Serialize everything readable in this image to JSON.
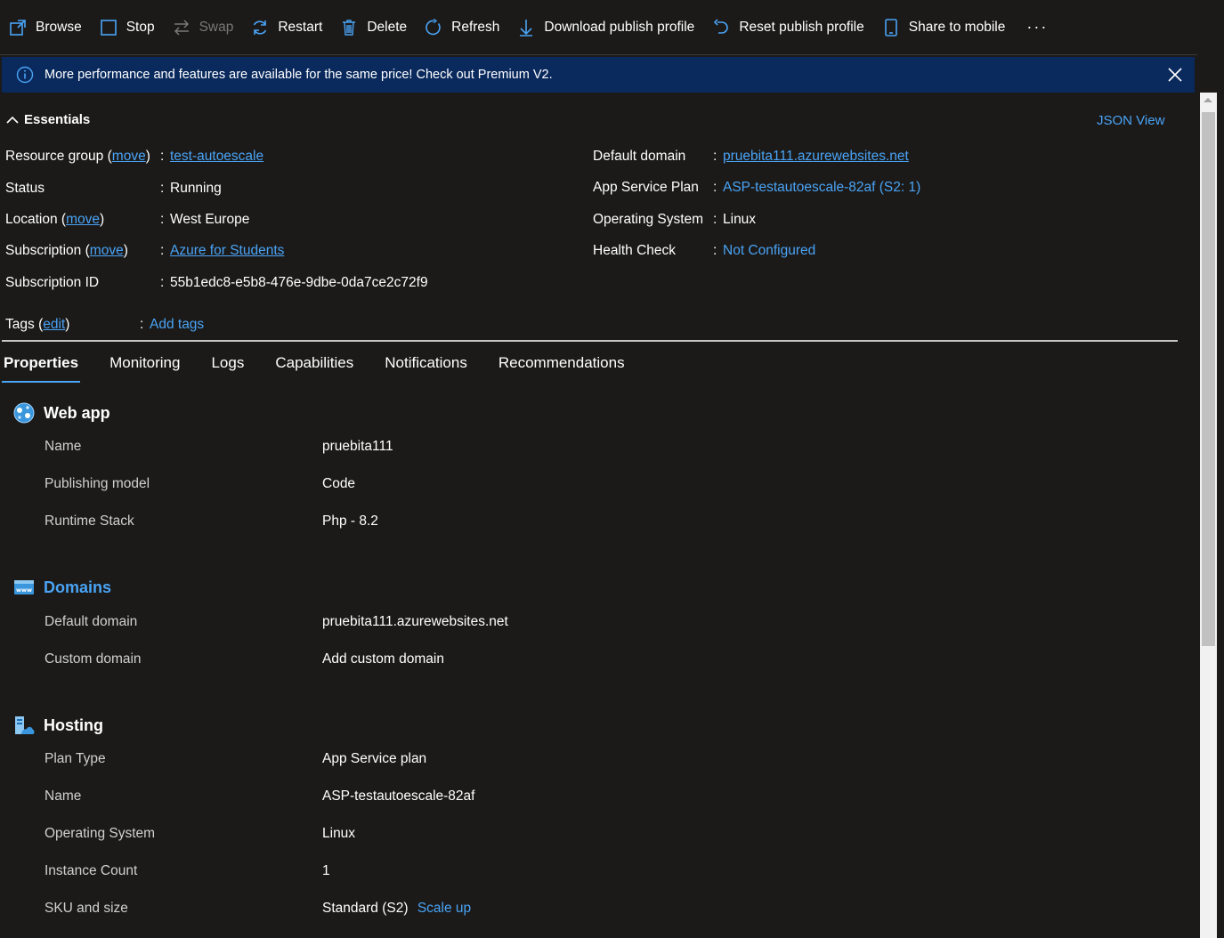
{
  "toolbar": {
    "browse": "Browse",
    "stop": "Stop",
    "swap": "Swap",
    "restart": "Restart",
    "delete": "Delete",
    "refresh": "Refresh",
    "download_profile": "Download publish profile",
    "reset_profile": "Reset publish profile",
    "share_mobile": "Share to mobile",
    "more": "···"
  },
  "banner": {
    "message": "More performance and features are available for the same price! Check out Premium V2."
  },
  "essentials": {
    "title": "Essentials",
    "json_view": "JSON View",
    "move": "move",
    "edit": "edit",
    "resource_group_label": "Resource group",
    "resource_group_value": "test-autoescale",
    "status_label": "Status",
    "status_value": "Running",
    "location_label": "Location",
    "location_value": "West Europe",
    "subscription_label": "Subscription",
    "subscription_value": "Azure for Students",
    "subscription_id_label": "Subscription ID",
    "subscription_id_value": "55b1edc8-e5b8-476e-9dbe-0da7ce2c72f9",
    "tags_label": "Tags",
    "tags_value": "Add tags",
    "default_domain_label": "Default domain",
    "default_domain_value": "pruebita111.azurewebsites.net",
    "app_service_plan_label": "App Service Plan",
    "app_service_plan_value": "ASP-testautoescale-82af (S2: 1)",
    "os_label": "Operating System",
    "os_value": "Linux",
    "health_label": "Health Check",
    "health_value": "Not Configured"
  },
  "tabs": [
    "Properties",
    "Monitoring",
    "Logs",
    "Capabilities",
    "Notifications",
    "Recommendations"
  ],
  "sections": {
    "webapp": {
      "title": "Web app",
      "rows": [
        {
          "label": "Name",
          "value": "pruebita111"
        },
        {
          "label": "Publishing model",
          "value": "Code"
        },
        {
          "label": "Runtime Stack",
          "value": "Php - 8.2"
        }
      ]
    },
    "domains": {
      "title": "Domains",
      "rows": [
        {
          "label": "Default domain",
          "value": "pruebita111.azurewebsites.net"
        },
        {
          "label": "Custom domain",
          "value": "Add custom domain"
        }
      ]
    },
    "hosting": {
      "title": "Hosting",
      "rows": [
        {
          "label": "Plan Type",
          "value": "App Service plan"
        },
        {
          "label": "Name",
          "value": "ASP-testautoescale-82af"
        },
        {
          "label": "Operating System",
          "value": "Linux"
        },
        {
          "label": "Instance Count",
          "value": "1"
        },
        {
          "label": "SKU and size",
          "value": "Standard (S2)"
        }
      ],
      "scale_up": "Scale up"
    }
  },
  "colors": {
    "background": "#1b1a19",
    "link": "#4aa3f5",
    "banner": "#0a2a5e"
  }
}
